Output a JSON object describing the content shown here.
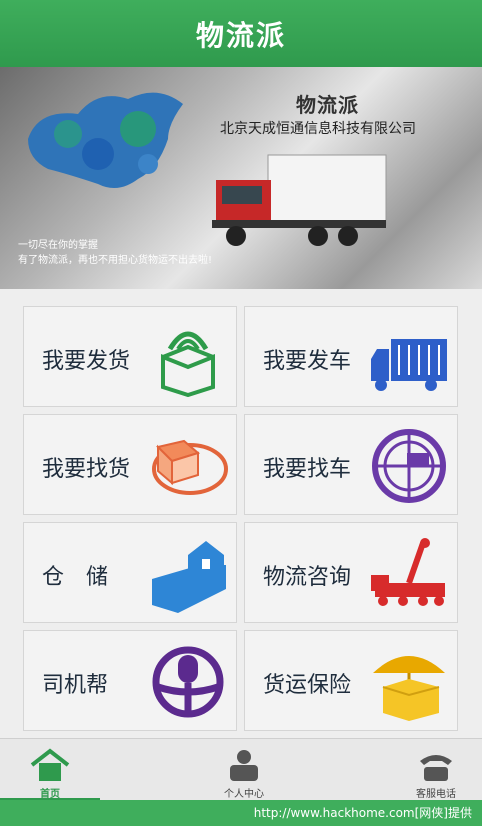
{
  "header": {
    "title": "物流派"
  },
  "banner": {
    "logo_text": "物流派",
    "company": "北京天成恒通信息科技有限公司",
    "slogan_line1": "一切尽在你的掌握",
    "slogan_line2": "有了物流派，再也不用担心货物运不出去啦!"
  },
  "tiles": [
    {
      "label": "我要发货",
      "icon": "box-icon"
    },
    {
      "label": "我要发车",
      "icon": "truck-icon"
    },
    {
      "label": "我要找货",
      "icon": "boxes-icon"
    },
    {
      "label": "我要找车",
      "icon": "radar-truck-icon"
    },
    {
      "label": "仓　储",
      "icon": "warehouse-icon"
    },
    {
      "label": "物流咨询",
      "icon": "crane-icon"
    },
    {
      "label": "司机帮",
      "icon": "steering-wheel-icon"
    },
    {
      "label": "货运保险",
      "icon": "umbrella-box-icon"
    }
  ],
  "tabs": [
    {
      "label": "首页",
      "icon": "home-icon"
    },
    {
      "label": "个人中心",
      "icon": "user-icon"
    },
    {
      "label": "客服电话",
      "icon": "phone-icon"
    }
  ],
  "footer": {
    "text": "http://www.hackhome.com[网侠]提供"
  }
}
